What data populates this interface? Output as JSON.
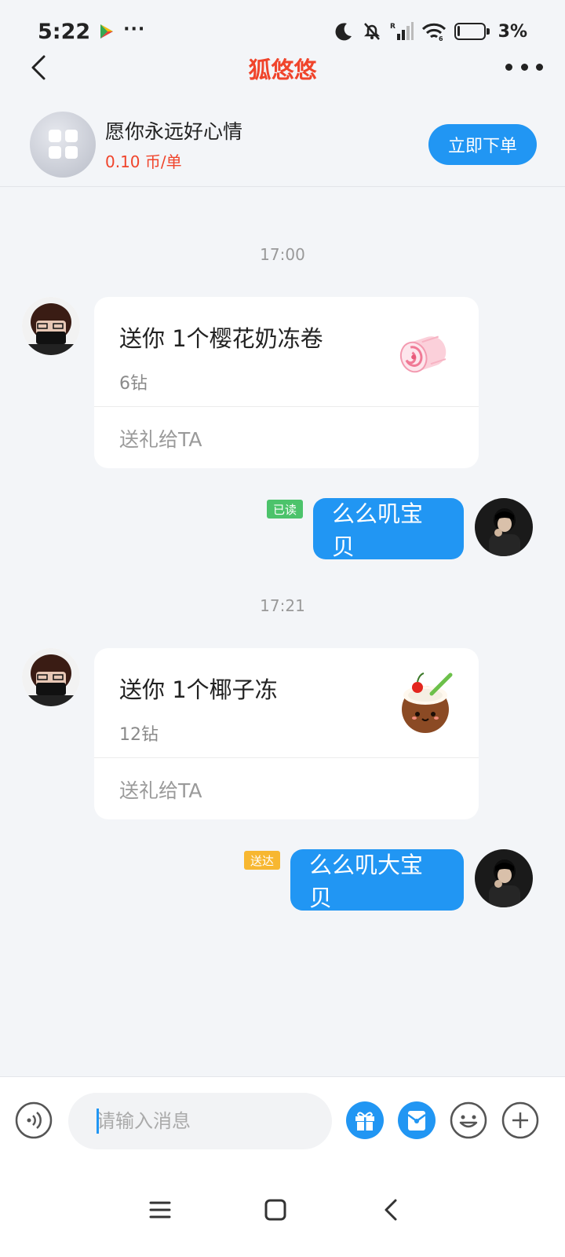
{
  "status_bar": {
    "time": "5:22",
    "overflow": "···",
    "battery": "3%",
    "icons": [
      "play-store-icon",
      "moon-icon",
      "mute-bell-icon",
      "signal-icon",
      "wifi-icon",
      "battery-icon"
    ]
  },
  "header": {
    "title": "狐悠悠",
    "back_icon": "chevron-left-icon",
    "more_icon": "more-dots-icon",
    "title_color": "#f0442b"
  },
  "service": {
    "name": "愿你永远好心情",
    "price": "0.10 币/单",
    "order_label": "立即下单",
    "icon": "grid-apps-icon"
  },
  "messages": [
    {
      "type": "timestamp",
      "text": "17:00"
    },
    {
      "type": "gift",
      "side": "left",
      "title": "送你 1个樱花奶冻卷",
      "cost": "6钻",
      "action": "送礼给TA",
      "gift_icon": "sakura-roll-icon"
    },
    {
      "type": "text",
      "side": "right",
      "text": "么么叽宝贝",
      "status": "已读",
      "status_color": "#4cc36b"
    },
    {
      "type": "timestamp",
      "text": "17:21"
    },
    {
      "type": "gift",
      "side": "left",
      "title": "送你 1个椰子冻",
      "cost": "12钻",
      "action": "送礼给TA",
      "gift_icon": "coconut-jelly-icon"
    },
    {
      "type": "text",
      "side": "right",
      "text": "么么叽大宝贝",
      "status": "送达",
      "status_color": "#f7b731"
    }
  ],
  "input_bar": {
    "placeholder": "请输入消息",
    "value": "",
    "buttons": [
      "voice-icon",
      "gift-icon",
      "red-packet-icon",
      "emoji-icon",
      "plus-icon"
    ]
  },
  "nav_bar": {
    "buttons": [
      "menu-icon",
      "home-icon",
      "back-icon"
    ]
  },
  "colors": {
    "accent": "#2196f3",
    "background": "#f3f5f8",
    "price": "#f0442b"
  }
}
